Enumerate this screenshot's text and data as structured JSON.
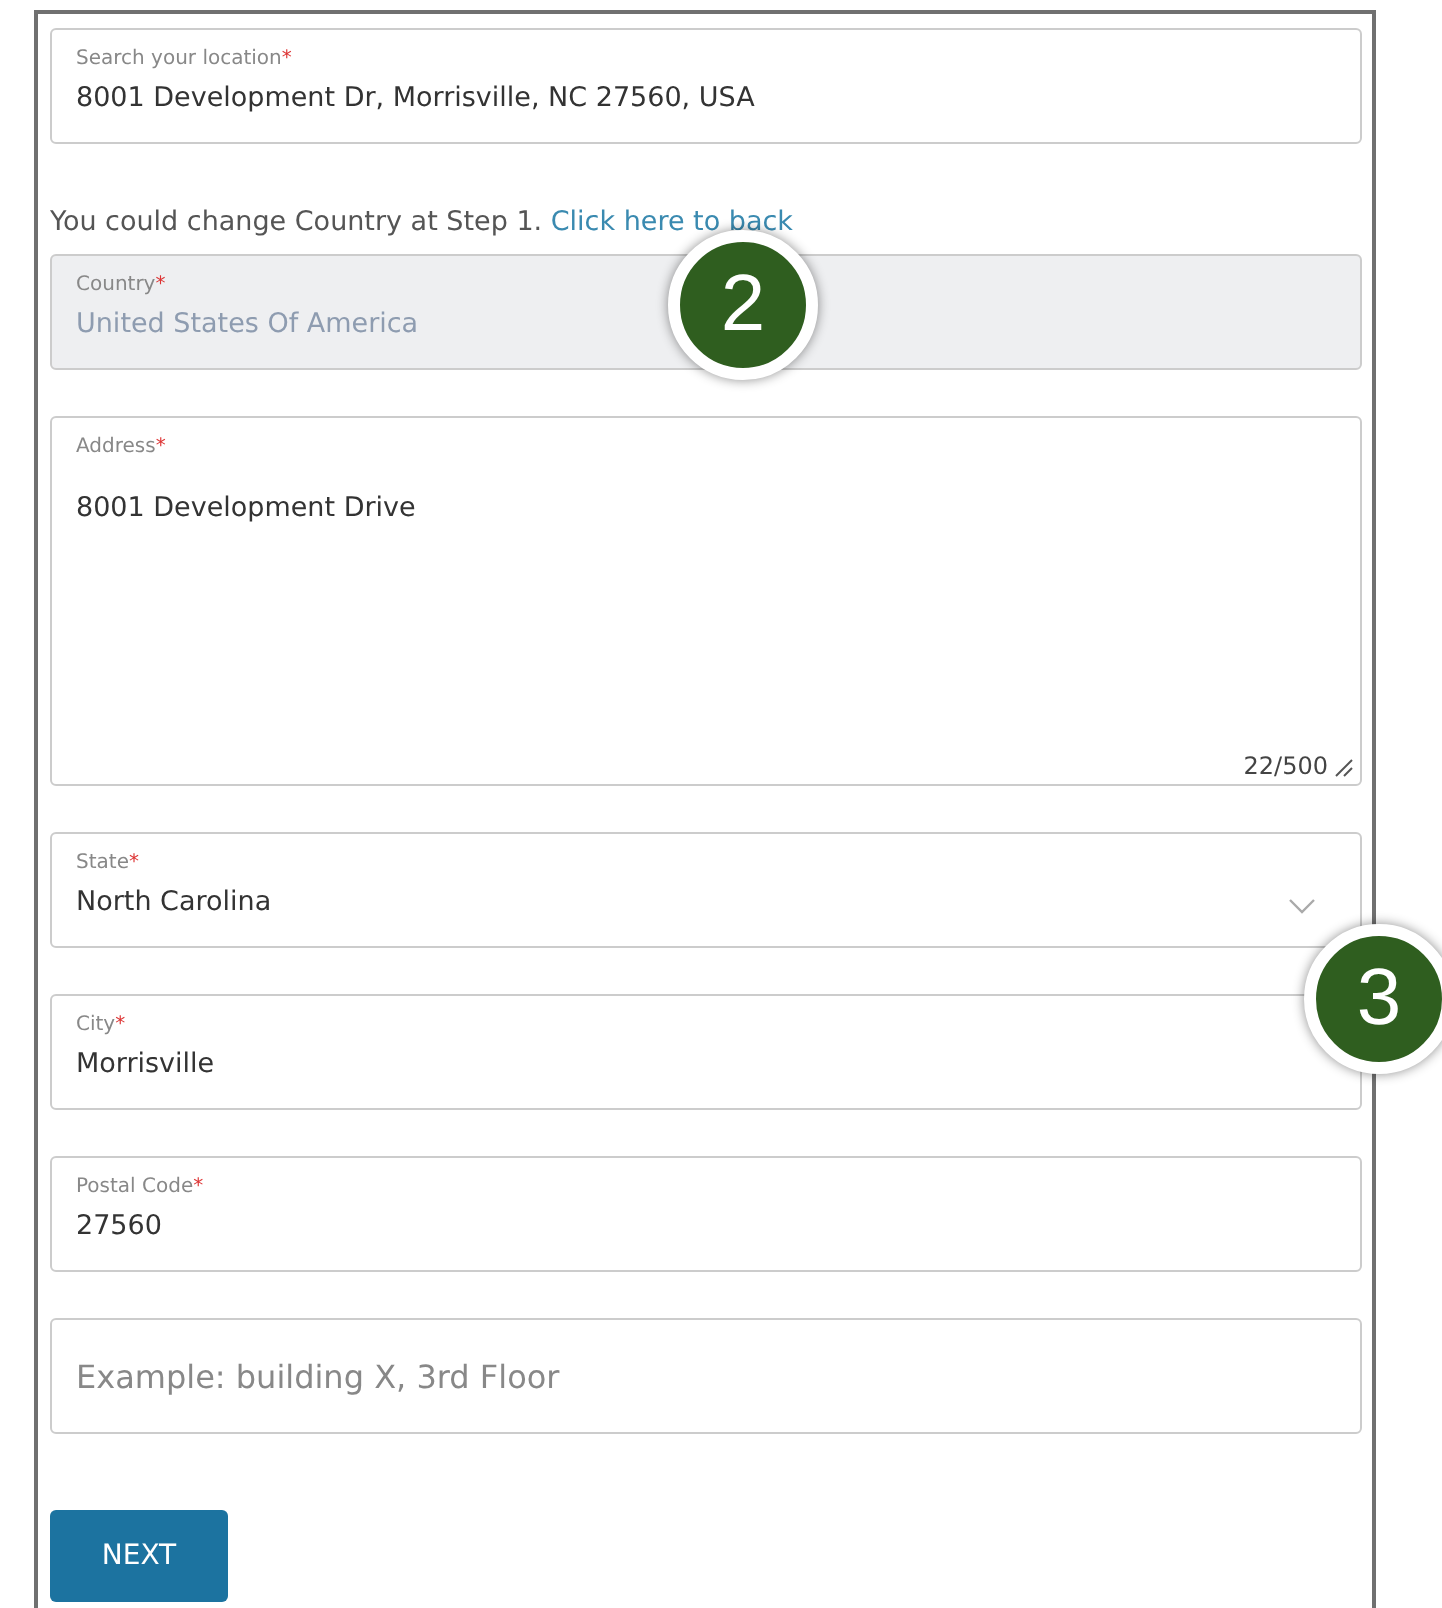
{
  "fields": [
    {
      "kind": "text",
      "label": "Search your location",
      "required_mark": "*",
      "value": "8001 Development Dr, Morrisville, NC 27560, USA"
    },
    {
      "kind": "note",
      "text": "You could change Country at Step 1.",
      "link": "Click here to back"
    },
    {
      "kind": "text",
      "label": "Country",
      "required_mark": "*",
      "value": "United States Of America",
      "disabled": true
    },
    {
      "kind": "textarea",
      "label": "Address",
      "required_mark": "*",
      "value": "8001 Development Drive",
      "counter": "22/500"
    },
    {
      "kind": "select",
      "label": "State",
      "required_mark": "*",
      "value": "North Carolina"
    },
    {
      "kind": "text",
      "label": "City",
      "required_mark": "*",
      "value": "Morrisville"
    },
    {
      "kind": "text",
      "label": "Postal Code",
      "required_mark": "*",
      "value": "27560"
    },
    {
      "kind": "placeholder",
      "placeholder": "Example: building X, 3rd Floor"
    }
  ],
  "next_button": "NEXT",
  "callouts": [
    "2",
    "3"
  ]
}
